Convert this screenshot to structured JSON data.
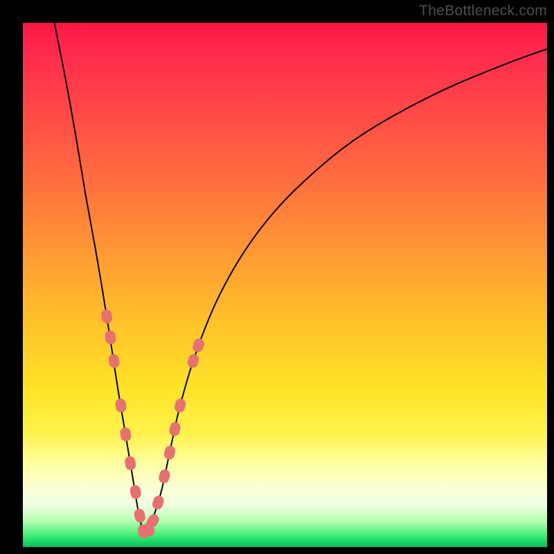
{
  "watermark": "TheBottleneck.com",
  "colors": {
    "curve": "#000000",
    "marker": "#e77070",
    "frame": "#000000"
  },
  "chart_data": {
    "type": "line",
    "title": "",
    "xlabel": "",
    "ylabel": "",
    "xlim": [
      0,
      100
    ],
    "ylim": [
      0,
      100
    ],
    "note": "Axes are unlabeled in the source image; values are normalized 0–100 in plot-area coordinates (x left→right, y bottom→top). Curve is a V-shaped bottleneck curve with minimum near x≈23.",
    "series": [
      {
        "name": "bottleneck-curve",
        "x": [
          6,
          8,
          10,
          12,
          14,
          16,
          18,
          19.5,
          21,
          22,
          23,
          24,
          25,
          26.5,
          28,
          30,
          33,
          37,
          42,
          48,
          55,
          63,
          72,
          82,
          93,
          100
        ],
        "y": [
          100,
          90,
          79,
          67,
          56,
          44,
          31,
          22,
          13,
          7,
          3,
          3.5,
          6,
          11,
          18,
          27,
          37,
          47,
          56,
          64,
          71,
          77.5,
          83,
          88,
          92.5,
          95
        ]
      }
    ],
    "markers": {
      "name": "highlighted-points",
      "style": "round",
      "color": "#e77070",
      "points_xy": [
        [
          16.0,
          44.0
        ],
        [
          16.7,
          40.0
        ],
        [
          17.4,
          35.5
        ],
        [
          18.7,
          27.0
        ],
        [
          19.6,
          21.5
        ],
        [
          20.5,
          16.0
        ],
        [
          21.5,
          10.5
        ],
        [
          22.3,
          6.0
        ],
        [
          23.0,
          3.0
        ],
        [
          24.0,
          3.3
        ],
        [
          24.8,
          5.0
        ],
        [
          25.8,
          8.5
        ],
        [
          27.0,
          13.5
        ],
        [
          28.0,
          18.0
        ],
        [
          29.0,
          22.5
        ],
        [
          30.0,
          27.0
        ],
        [
          32.5,
          35.5
        ],
        [
          33.5,
          38.5
        ]
      ]
    }
  }
}
